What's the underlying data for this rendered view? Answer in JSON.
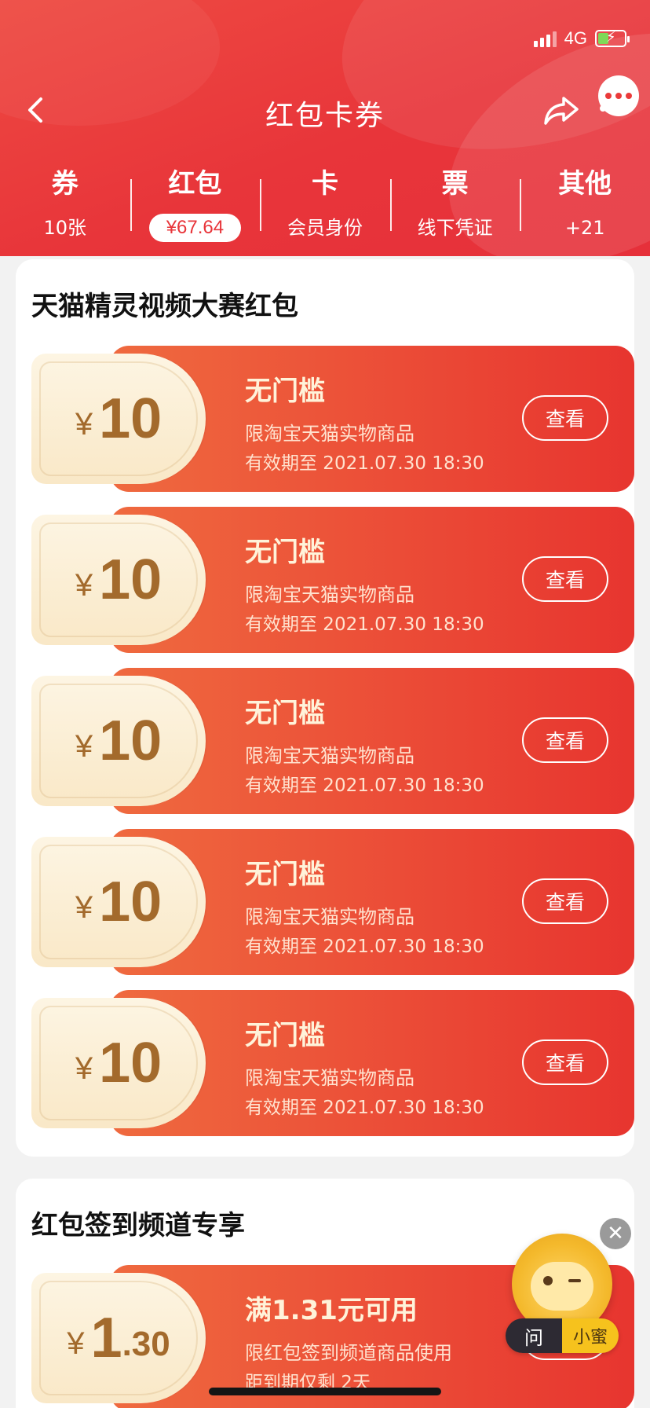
{
  "status_bar": {
    "network": "4G",
    "icons": [
      "signal-icon",
      "battery-charging-icon"
    ],
    "battery_level": 0.4
  },
  "nav": {
    "title": "红包卡券",
    "back_icon": "chevron-left-icon",
    "share_icon": "share-icon",
    "more_icon": "more-icon"
  },
  "tabs": [
    {
      "title": "券",
      "sub": "10张",
      "active": false
    },
    {
      "title": "红包",
      "sub": "¥67.64",
      "active": true
    },
    {
      "title": "卡",
      "sub": "会员身份",
      "active": false
    },
    {
      "title": "票",
      "sub": "线下凭证",
      "active": false
    },
    {
      "title": "其他",
      "sub": "+21",
      "active": false
    }
  ],
  "sections": [
    {
      "title": "天猫精灵视频大赛红包",
      "coupons": [
        {
          "currency": "¥",
          "amount": "10",
          "amount_decimal": "",
          "name": "无门槛",
          "scope": "限淘宝天猫实物商品",
          "validity": "有效期至 2021.07.30 18:30",
          "button": "查看"
        },
        {
          "currency": "¥",
          "amount": "10",
          "amount_decimal": "",
          "name": "无门槛",
          "scope": "限淘宝天猫实物商品",
          "validity": "有效期至 2021.07.30 18:30",
          "button": "查看"
        },
        {
          "currency": "¥",
          "amount": "10",
          "amount_decimal": "",
          "name": "无门槛",
          "scope": "限淘宝天猫实物商品",
          "validity": "有效期至 2021.07.30 18:30",
          "button": "查看"
        },
        {
          "currency": "¥",
          "amount": "10",
          "amount_decimal": "",
          "name": "无门槛",
          "scope": "限淘宝天猫实物商品",
          "validity": "有效期至 2021.07.30 18:30",
          "button": "查看"
        },
        {
          "currency": "¥",
          "amount": "10",
          "amount_decimal": "",
          "name": "无门槛",
          "scope": "限淘宝天猫实物商品",
          "validity": "有效期至 2021.07.30 18:30",
          "button": "查看"
        }
      ]
    },
    {
      "title": "红包签到频道专享",
      "coupons": [
        {
          "currency": "¥",
          "amount": "1",
          "amount_decimal": ".30",
          "name": "满1.31元可用",
          "scope": "限红包签到频道商品使用",
          "validity": "距到期仅剩 2天",
          "button": "查看"
        }
      ]
    }
  ],
  "assistant": {
    "close": "✕",
    "ask": "问",
    "name": "小蜜"
  },
  "colors": {
    "brand_red": "#e8353a",
    "stub_gold": "#a36a2c",
    "assistant_yellow": "#f6c21d"
  }
}
